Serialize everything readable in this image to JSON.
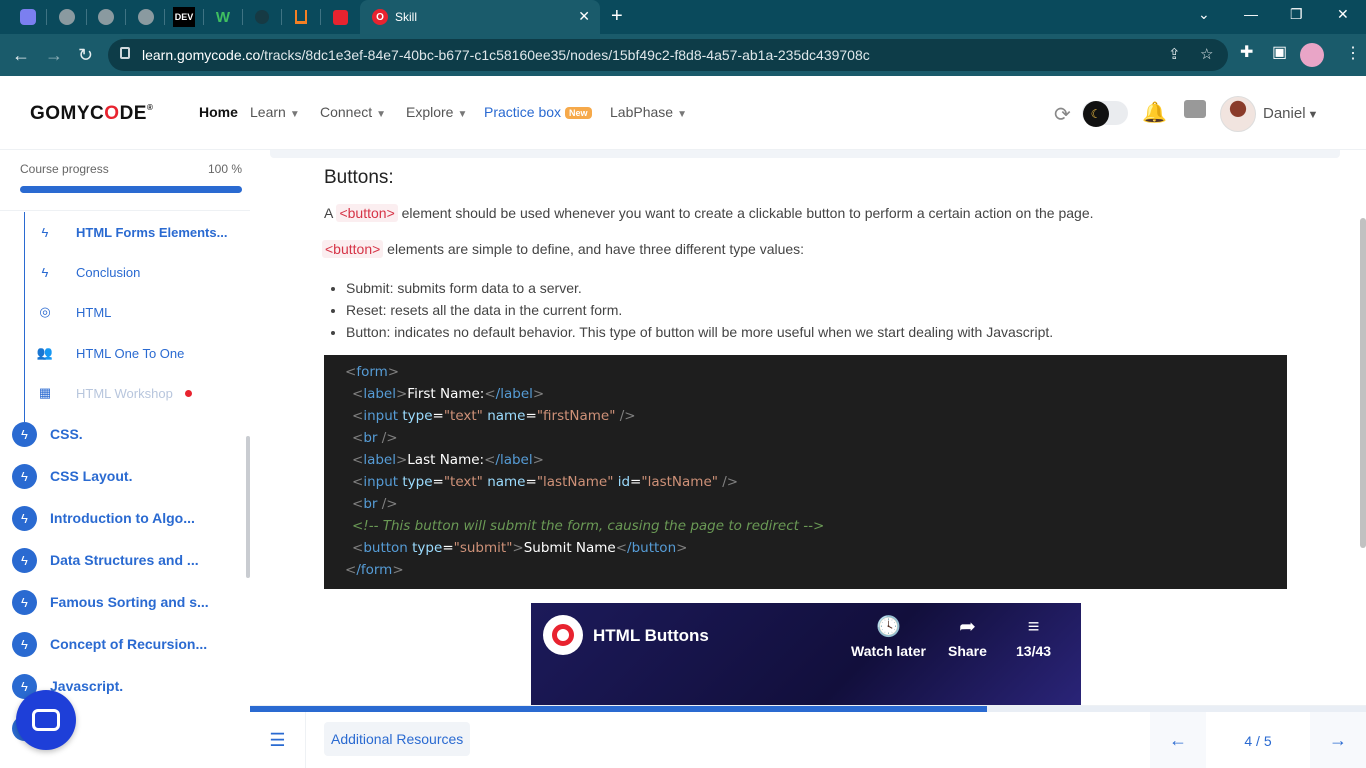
{
  "browser": {
    "tab_title": "Skill",
    "tab_close": "✕",
    "new_tab": "+",
    "url_host": "learn.gomycode.co",
    "url_path": "/tracks/8dc1e3ef-84e7-40bc-b677-c1c58160ee35/nodes/15bf49c2-f8d8-4a57-ab1a-235dc439708c",
    "pinned_tab_labels": [
      "DEV",
      "W"
    ]
  },
  "header": {
    "logo_text_a": "GOMYC",
    "logo_text_b": "O",
    "logo_text_c": "DE",
    "logo_reg": "®",
    "nav": [
      {
        "label": "Home"
      },
      {
        "label": "Learn"
      },
      {
        "label": "Connect"
      },
      {
        "label": "Explore"
      },
      {
        "label": "Practice box"
      },
      {
        "label": "LabPhase"
      }
    ],
    "new_badge": "New",
    "username": "Daniel",
    "accent_color": "#2a6ad1"
  },
  "sidebar": {
    "progress_label": "Course progress",
    "progress_value": "100 %",
    "progress_fraction": 1.0,
    "sub_items": [
      {
        "label": "HTML Forms Elements...",
        "icon": "bolt-icon"
      },
      {
        "label": "Conclusion",
        "icon": "bolt-icon"
      },
      {
        "label": "HTML",
        "icon": "target-icon"
      },
      {
        "label": "HTML One To One",
        "icon": "people-icon"
      },
      {
        "label": "HTML Workshop",
        "icon": "workshop-icon"
      }
    ],
    "courses": [
      {
        "label": "CSS."
      },
      {
        "label": "CSS Layout."
      },
      {
        "label": "Introduction to Algo..."
      },
      {
        "label": "Data Structures and ..."
      },
      {
        "label": "Famous Sorting and s..."
      },
      {
        "label": "Concept of Recursion..."
      },
      {
        "label": "Javascript."
      },
      {
        "label": "M"
      }
    ]
  },
  "content": {
    "heading": "Buttons:",
    "p1_before": "A ",
    "p1_code": "<button>",
    "p1_after": " element should be used whenever you want to create a clickable button to perform a certain action on the page.",
    "p2_code": "<button>",
    "p2_after": " elements are simple to define, and have three different type values:",
    "bullets": [
      "Submit: submits form data to a server.",
      "Reset: resets all the data in the current form.",
      "Button: indicates no default behavior. This type of button will be more useful when we start dealing with Javascript."
    ],
    "code": {
      "lt": "<",
      "gt": ">",
      "sgt": " />",
      "eq": "=",
      "form": "form",
      "label": "label",
      "label_close": "/label",
      "form_close": "/form",
      "input": "input",
      "br": "br",
      "button": "button",
      "button_close": "/button",
      "attr_type": "type",
      "attr_name": "name",
      "attr_id": "id",
      "val_text": "\"text\"",
      "val_firstName": "\"firstName\"",
      "val_lastName": "\"lastName\"",
      "val_submit": "\"submit\"",
      "first_name_text": "First Name:",
      "last_name_text": "Last Name:",
      "submit_text": "Submit Name",
      "comment": "<!-- This button will submit the form, causing the page to redirect -->"
    },
    "video": {
      "title": "HTML Buttons",
      "watch_later": "Watch later",
      "share": "Share",
      "playlist": "13/43"
    }
  },
  "bottom": {
    "resources_label": "Additional Resources",
    "pager": "4 / 5",
    "lesson_progress_fraction": 0.66
  }
}
